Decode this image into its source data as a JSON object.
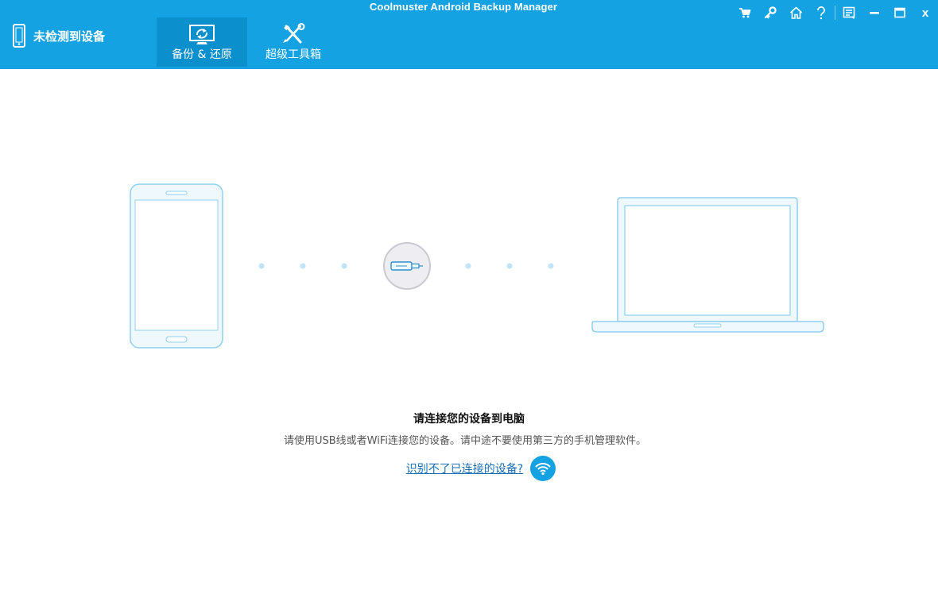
{
  "app": {
    "title": "Coolmuster Android Backup Manager"
  },
  "header": {
    "device_status": "未检测到设备",
    "tabs": [
      {
        "label": "备份 & 还原",
        "icon": "backup-restore-icon",
        "active": true
      },
      {
        "label": "超级工具箱",
        "icon": "toolbox-icon",
        "active": false
      }
    ],
    "titlebar_buttons": [
      "cart-icon",
      "key-icon",
      "home-icon",
      "help-icon",
      "feedback-icon",
      "minimize-icon",
      "maximize-icon",
      "close-icon"
    ],
    "close_label": "x"
  },
  "main": {
    "prompt_title": "请连接您的设备到电脑",
    "prompt_sub": "请使用USB线或者WiFi连接您的设备。请中途不要使用第三方的手机管理软件。",
    "help_link": "识别不了已连接的设备?",
    "wifi_button_icon": "wifi-icon"
  },
  "colors": {
    "accent": "#15a2e2",
    "active_tab": "#0c8fcd",
    "illustration_stroke": "#8fd0ef",
    "illustration_fill": "#eef8fd",
    "link": "#1a6fb5"
  }
}
